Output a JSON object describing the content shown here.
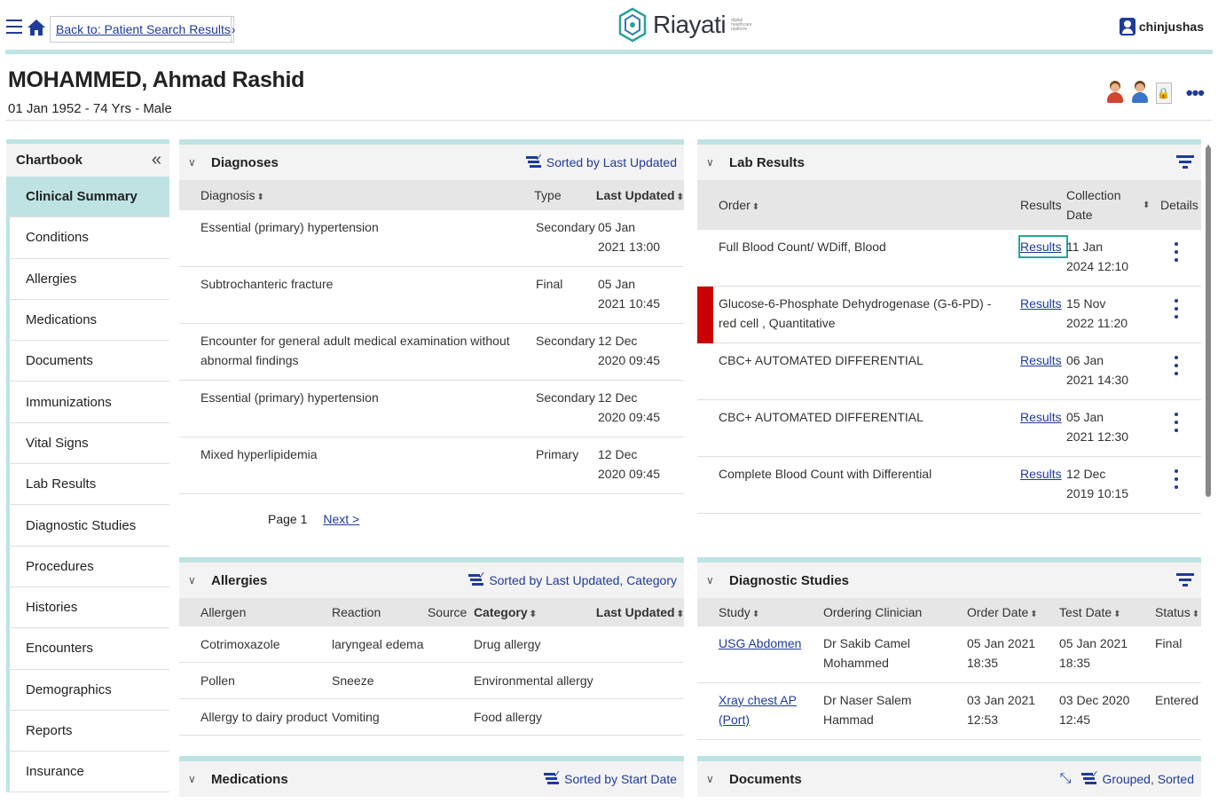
{
  "topbar": {
    "back_link": "Back to: Patient Search Results",
    "logo_text": "Riayati",
    "logo_sub": "digital healthcare platform",
    "username": "chinjushas"
  },
  "patient": {
    "name": "MOHAMMED, Ahmad Rashid",
    "demographics": "01 Jan 1952 - 74 Yrs - Male"
  },
  "sidebar": {
    "title": "Chartbook",
    "items": [
      {
        "label": "Clinical Summary",
        "active": true
      },
      {
        "label": "Conditions"
      },
      {
        "label": "Allergies"
      },
      {
        "label": "Medications"
      },
      {
        "label": "Documents"
      },
      {
        "label": "Immunizations"
      },
      {
        "label": "Vital Signs"
      },
      {
        "label": "Lab Results"
      },
      {
        "label": "Diagnostic Studies"
      },
      {
        "label": "Procedures"
      },
      {
        "label": "Histories"
      },
      {
        "label": "Encounters"
      },
      {
        "label": "Demographics"
      },
      {
        "label": "Reports"
      },
      {
        "label": "Insurance"
      }
    ]
  },
  "diagnoses": {
    "title": "Diagnoses",
    "sort_label": "Sorted by Last Updated",
    "columns": [
      "Diagnosis",
      "Type",
      "Last Updated"
    ],
    "rows": [
      {
        "diagnosis": "Essential (primary) hypertension",
        "type": "Secondary",
        "date": "05 Jan",
        "time": "2021 13:00"
      },
      {
        "diagnosis": "Subtrochanteric fracture",
        "type": "Final",
        "date": "05 Jan",
        "time": "2021 10:45"
      },
      {
        "diagnosis": "Encounter for general adult medical examination without abnormal findings",
        "type": "Secondary",
        "date": "12 Dec",
        "time": "2020 09:45"
      },
      {
        "diagnosis": "Essential (primary) hypertension",
        "type": "Secondary",
        "date": "12 Dec",
        "time": "2020 09:45"
      },
      {
        "diagnosis": "Mixed hyperlipidemia",
        "type": "Primary",
        "date": "12 Dec",
        "time": "2020 09:45"
      }
    ],
    "page_label": "Page 1",
    "next_label": "Next >"
  },
  "lab_results": {
    "title": "Lab Results",
    "columns": {
      "order": "Order",
      "results": "Results",
      "collection": "Collection Date",
      "details": "Details"
    },
    "rows": [
      {
        "order": "Full Blood Count/ WDiff, Blood",
        "results": "Results",
        "date": "11 Jan",
        "time": "2024 12:10",
        "flag": false
      },
      {
        "order": "Glucose-6-Phosphate Dehydrogenase (G-6-PD) - red cell , Quantitative",
        "results": "Results",
        "date": "15 Nov",
        "time": "2022 11:20",
        "flag": true
      },
      {
        "order": "CBC+ AUTOMATED DIFFERENTIAL",
        "results": "Results",
        "date": "06 Jan",
        "time": "2021 14:30",
        "flag": false
      },
      {
        "order": "CBC+ AUTOMATED DIFFERENTIAL",
        "results": "Results",
        "date": "05 Jan",
        "time": "2021 12:30",
        "flag": false
      },
      {
        "order": "Complete Blood Count with Differential",
        "results": "Results",
        "date": "12 Dec",
        "time": "2019 10:15",
        "flag": false
      }
    ],
    "flag_color": "#cc0000"
  },
  "allergies": {
    "title": "Allergies",
    "sort_label": "Sorted by Last Updated, Category",
    "columns": [
      "Allergen",
      "Reaction",
      "Source",
      "Category",
      "Last Updated"
    ],
    "rows": [
      {
        "allergen": "Cotrimoxazole",
        "reaction": "laryngeal edema",
        "source": "",
        "category": "Drug allergy",
        "updated": ""
      },
      {
        "allergen": "Pollen",
        "reaction": "Sneeze",
        "source": "",
        "category": "Environmental allergy",
        "updated": ""
      },
      {
        "allergen": "Allergy to dairy product",
        "reaction": "Vomiting",
        "source": "",
        "category": "Food allergy",
        "updated": ""
      }
    ]
  },
  "diagnostic_studies": {
    "title": "Diagnostic Studies",
    "columns": [
      "Study",
      "Ordering Clinician",
      "Order Date",
      "Test Date",
      "Status"
    ],
    "rows": [
      {
        "study": "USG Abdomen",
        "clinician": "Dr Sakib Camel Mohammed",
        "order_date": "05 Jan 2021 18:35",
        "test_date": "05 Jan 2021 18:35",
        "status": "Final"
      },
      {
        "study": "Xray chest AP (Port)",
        "clinician": "Dr Naser Salem Hammad",
        "order_date": "03 Jan 2021 12:53",
        "test_date": "03 Dec 2020 12:45",
        "status": "Entered"
      }
    ]
  },
  "medications": {
    "title": "Medications",
    "sort_label": "Sorted by Start Date"
  },
  "documents": {
    "title": "Documents",
    "sort_label": "Grouped, Sorted"
  },
  "colors": {
    "accent": "#bfe3e3",
    "link": "#1f3b99",
    "header_bg": "#f3f3f3",
    "column_bg": "#e6e6e6"
  }
}
